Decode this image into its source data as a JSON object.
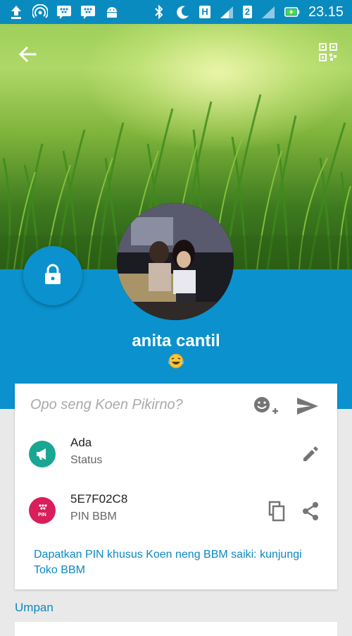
{
  "status_bar": {
    "time": "23.15",
    "network_label": "H",
    "sim2_label": "2"
  },
  "profile": {
    "name": "anita cantil",
    "avatar_alt": "profile photo"
  },
  "status_input": {
    "placeholder": "Opo seng Koen Pikirno?"
  },
  "status_row": {
    "primary": "Ada",
    "secondary": "Status",
    "icon_color": "#1aa693"
  },
  "pin_row": {
    "primary": "5E7F02C8",
    "secondary": "PIN BBM",
    "icon_label": "PIN",
    "icon_color": "#d81e5b"
  },
  "pin_promo": {
    "text": "Dapatkan PIN khusus Koen neng BBM saiki: kunjungi Toko BBM"
  },
  "feed": {
    "label": "Umpan"
  },
  "colors": {
    "accent": "#0b91cd",
    "link": "#0b88c4"
  }
}
